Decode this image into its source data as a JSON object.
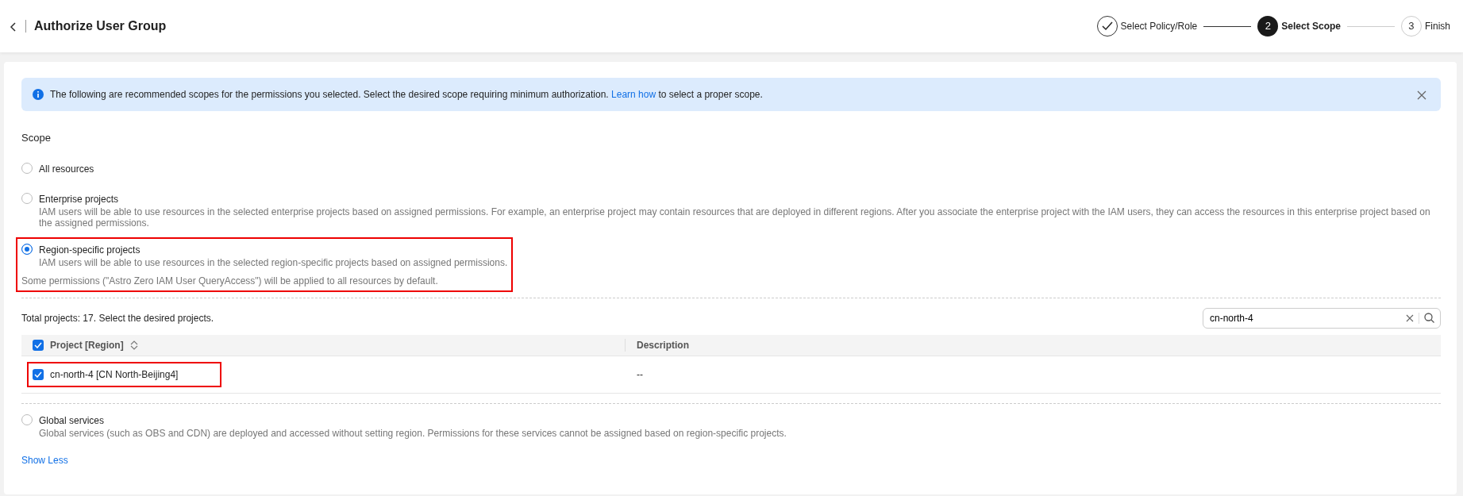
{
  "header": {
    "title": "Authorize User Group"
  },
  "steps": [
    {
      "label": "Select Policy/Role",
      "kind": "done"
    },
    {
      "number": "2",
      "label": "Select Scope",
      "kind": "active"
    },
    {
      "number": "3",
      "label": "Finish",
      "kind": "pending"
    }
  ],
  "alert": {
    "text": "The following are recommended scopes for the permissions you selected. Select the desired scope requiring minimum authorization.",
    "link": "Learn how",
    "text_after": "to select a proper scope."
  },
  "scope": {
    "label": "Scope",
    "options": [
      {
        "label": "All resources",
        "selected": false,
        "highlighted": false
      },
      {
        "label": "Enterprise projects",
        "description": "IAM users will be able to use resources in the selected enterprise projects based on assigned permissions. For example, an enterprise project may contain resources that are deployed in different regions. After you associate the enterprise project with the IAM users, they can access the resources in this enterprise project based on the assigned permissions.",
        "selected": false,
        "highlighted": false
      },
      {
        "label": "Region-specific projects",
        "description": "IAM users will be able to use resources in the selected region-specific projects based on assigned permissions.",
        "note": "Some permissions (\"Astro Zero IAM User QueryAccess\") will be applied to all resources by default.",
        "selected": true,
        "highlighted": true,
        "projects": {
          "summary": "Total projects: 17. Select the desired projects.",
          "search": {
            "value": "cn-north-4"
          },
          "all_checked": true,
          "columns": [
            {
              "label": "Project [Region]",
              "sortable": true
            },
            {
              "label": "Description",
              "sortable": false
            }
          ],
          "rows": [
            {
              "project": "cn-north-4 [CN North-Beijing4]",
              "description": "--",
              "checked": true,
              "highlighted": true
            }
          ]
        }
      },
      {
        "label": "Global services",
        "description": "Global services (such as OBS and CDN) are deployed and accessed without setting region. Permissions for these services cannot be assigned based on region-specific projects.",
        "selected": false,
        "highlighted": false
      }
    ]
  },
  "show_less": "Show Less"
}
